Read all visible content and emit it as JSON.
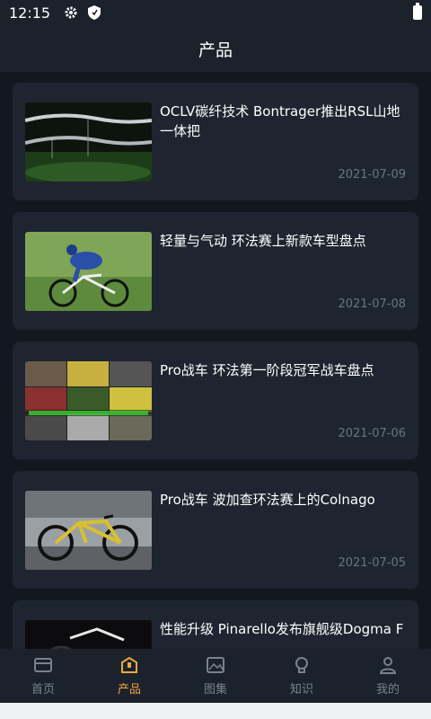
{
  "status_bar": {
    "time": "12:15",
    "icons": [
      "gear-icon",
      "shield-icon",
      "battery-icon"
    ]
  },
  "header": {
    "title": "产品"
  },
  "articles": [
    {
      "title": "OCLV碳纤技术 Bontrager推出RSL山地一体把",
      "date": "2021-07-09",
      "thumb": "handlebar-photo"
    },
    {
      "title": "轻量与气动 环法赛上新款车型盘点",
      "date": "2021-07-08",
      "thumb": "cyclist-photo"
    },
    {
      "title": "Pro战车 环法第一阶段冠军战车盘点",
      "date": "2021-07-06",
      "thumb": "collage-photo"
    },
    {
      "title": "Pro战车 波加查环法赛上的Colnago",
      "date": "2021-07-05",
      "thumb": "colnago-bike-photo"
    },
    {
      "title": "性能升级 Pinarello发布旗舰级Dogma F",
      "date": "",
      "thumb": "pinarello-bike-photo"
    }
  ],
  "bottom_nav": [
    {
      "label": "首页",
      "icon": "home-icon",
      "active": false
    },
    {
      "label": "产品",
      "icon": "product-icon",
      "active": true
    },
    {
      "label": "图集",
      "icon": "gallery-icon",
      "active": false
    },
    {
      "label": "知识",
      "icon": "knowledge-icon",
      "active": false
    },
    {
      "label": "我的",
      "icon": "profile-icon",
      "active": false
    }
  ],
  "colors": {
    "accent": "#f0a640",
    "background": "#131820",
    "card": "#1e2530",
    "inactive": "#7a8290"
  }
}
